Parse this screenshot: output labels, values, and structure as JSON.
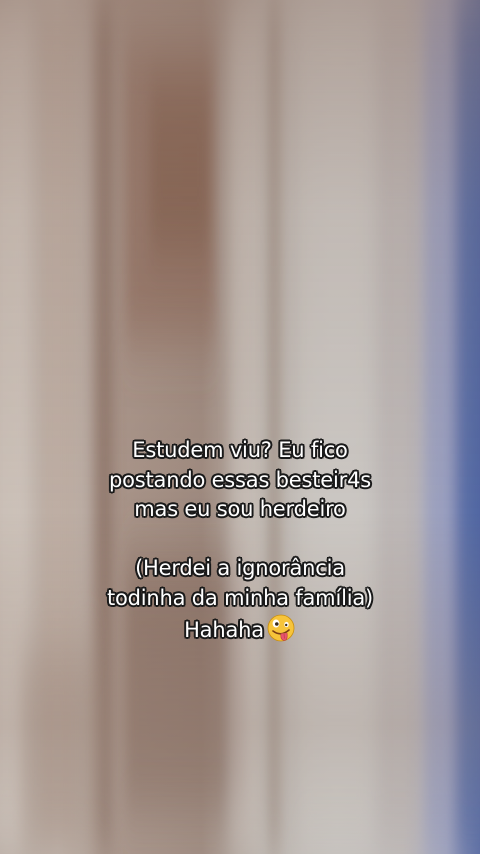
{
  "caption": {
    "line1": "Estudem viu? Eu fico",
    "line2": "postando essas besteir4s",
    "line3": "mas eu sou herdeiro",
    "line4": "(Herdei a ignorância",
    "line5": "todinha da minha família)",
    "line6": "Hahaha"
  },
  "emoji": {
    "icon": "zany-face-emoji-icon"
  },
  "colors": {
    "text": "#ffffff",
    "outline": "#1a1a1a"
  }
}
